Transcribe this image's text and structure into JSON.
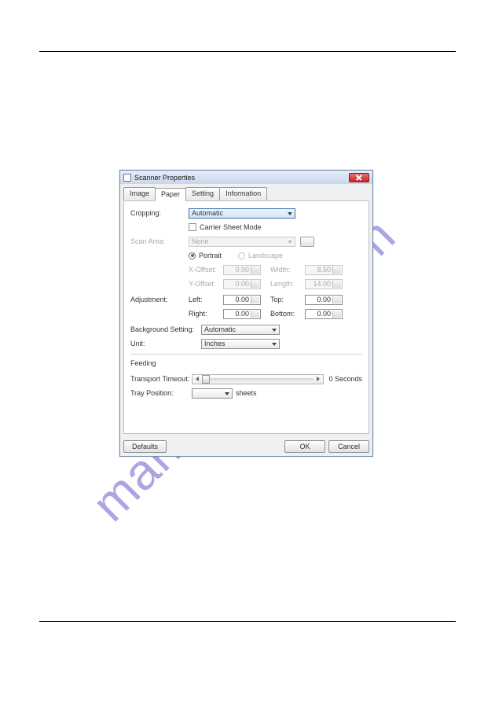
{
  "watermark": "manualshive.com",
  "dialog": {
    "title": "Scanner Properties",
    "tabs": {
      "image": "Image",
      "paper": "Paper",
      "setting": "Setting",
      "information": "Information"
    },
    "cropping": {
      "label": "Cropping:",
      "value": "Automatic",
      "carrier_label": "Carrier Sheet Mode"
    },
    "scanarea": {
      "label": "Scan Area:",
      "value": "None",
      "portrait": "Portrait",
      "landscape": "Landscape",
      "xoffset_label": "X-Offset:",
      "xoffset": "0.00",
      "yoffset_label": "Y-Offset:",
      "yoffset": "0.00",
      "width_label": "Width:",
      "width": "8.50",
      "length_label": "Length:",
      "length": "14.00"
    },
    "adjustment": {
      "label": "Adjustment:",
      "left_label": "Left:",
      "left": "0.00",
      "right_label": "Right:",
      "right": "0.00",
      "top_label": "Top:",
      "top": "0.00",
      "bottom_label": "Bottom:",
      "bottom": "0.00"
    },
    "background": {
      "label": "Background Setting:",
      "value": "Automatic"
    },
    "unit": {
      "label": "Unit:",
      "value": "Inches"
    },
    "feeding": {
      "title": "Feeding",
      "timeout_label": "Transport Timeout:",
      "timeout_value": "0 Seconds",
      "tray_label": "Tray Position:",
      "tray_value": "",
      "sheets": "sheets"
    },
    "buttons": {
      "defaults": "Defaults",
      "ok": "OK",
      "cancel": "Cancel"
    }
  }
}
